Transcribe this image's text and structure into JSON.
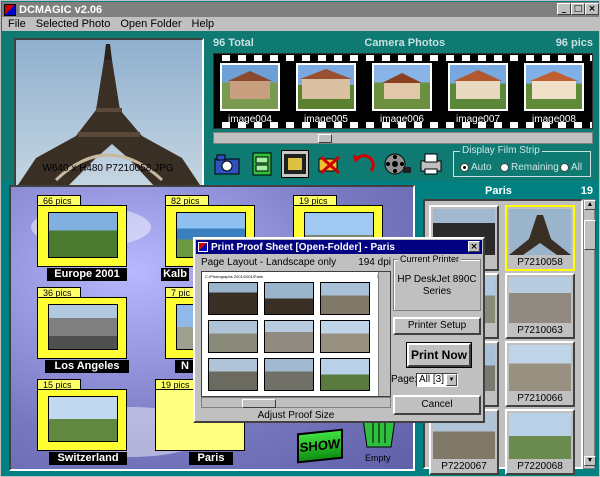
{
  "app": {
    "title": "DCMAGIC v2.06"
  },
  "titlebar_buttons": {
    "minimize": "_",
    "maximize": "□",
    "close": "×"
  },
  "menu": [
    {
      "label": "File",
      "underline": "F"
    },
    {
      "label": "Selected Photo",
      "underline": "S"
    },
    {
      "label": "Open Folder",
      "underline": "O"
    },
    {
      "label": "Help",
      "underline": "H"
    }
  ],
  "main_photo": {
    "caption": "W640 x H480    P7210058.JPG"
  },
  "film_strip": {
    "total_label": "96 Total",
    "title": "Camera Photos",
    "count_label": "96 pics",
    "frames": [
      "image004",
      "image005",
      "image006",
      "image007",
      "image008"
    ]
  },
  "toolbar": {
    "icons": [
      "camera-icon",
      "cabinet-icon",
      "film-frame-icon",
      "delete-camera-icon",
      "undo-arrow-icon",
      "film-reel-icon",
      "printer-icon"
    ]
  },
  "display_film_strip": {
    "legend": "Display Film Strip",
    "options": [
      "Auto",
      "Remaining",
      "All"
    ],
    "selected": "Auto"
  },
  "folders": [
    {
      "count": "66 pics",
      "name": "Europe 2001"
    },
    {
      "count": "82 pics",
      "name": "Kalb"
    },
    {
      "count": "19 pics",
      "name": ""
    },
    {
      "count": "36 pics",
      "name": "Los Angeles"
    },
    {
      "count": "7 pic",
      "name": "N"
    },
    {
      "count": "15 pics",
      "name": "Switzerland"
    },
    {
      "count": "19 pics",
      "name": "Paris"
    }
  ],
  "show_button": "SHOW",
  "trash_label": "Empty",
  "right_panel": {
    "title": "Paris",
    "count": "19",
    "thumbs": [
      {
        "caption": "",
        "selected": false
      },
      {
        "caption": "P7210058",
        "selected": true
      },
      {
        "caption": "",
        "selected": false
      },
      {
        "caption": "P7210063",
        "selected": false
      },
      {
        "caption": "",
        "selected": false
      },
      {
        "caption": "P7210066",
        "selected": false
      },
      {
        "caption": "P7220067",
        "selected": false
      },
      {
        "caption": "P7220068",
        "selected": false
      }
    ]
  },
  "dialog": {
    "title": "Print Proof Sheet [Open-Folder] - Paris",
    "layout_label": "Page Layout - Landscape only",
    "dpi": "194 dpi",
    "page_header_left": "C:\\Photographs 2001\\2001\\Paris",
    "page_header_right": "1 page",
    "adjust_label": "Adjust Proof Size",
    "current_printer_legend": "Current Printer",
    "printer_name": "HP DeskJet 890C Series",
    "printer_setup_button": "Printer Setup",
    "print_now_button": "Print Now",
    "page_label": "Page:",
    "page_value": "All [3]",
    "cancel_button": "Cancel"
  }
}
